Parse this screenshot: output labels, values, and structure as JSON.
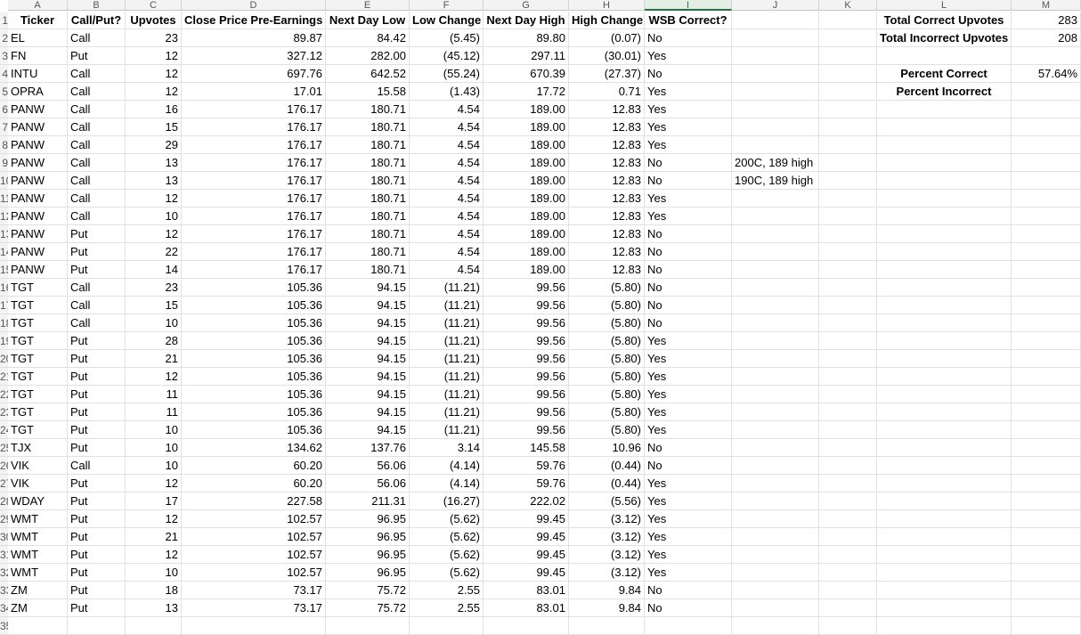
{
  "column_letters": [
    "A",
    "B",
    "C",
    "D",
    "E",
    "F",
    "G",
    "H",
    "I",
    "J",
    "K",
    "L",
    "M"
  ],
  "row_numbers": [
    "1",
    "2",
    "3",
    "4",
    "5",
    "6",
    "7",
    "8",
    "9",
    "10",
    "11",
    "12",
    "13",
    "14",
    "15",
    "16",
    "17",
    "18",
    "19",
    "20",
    "21",
    "22",
    "23",
    "24",
    "25",
    "26",
    "27",
    "28",
    "29",
    "30",
    "31",
    "32",
    "33",
    "34",
    "35"
  ],
  "headers": [
    "Ticker",
    "Call/Put?",
    "Upvotes",
    "Close Price Pre-Earnings",
    "Next Day Low",
    "Low Change",
    "Next Day High",
    "High Change",
    "WSB Correct?"
  ],
  "rows": [
    [
      "EL",
      "Call",
      "23",
      "89.87",
      "84.42",
      "(5.45)",
      "89.80",
      "(0.07)",
      "No"
    ],
    [
      "FN",
      "Put",
      "12",
      "327.12",
      "282.00",
      "(45.12)",
      "297.11",
      "(30.01)",
      "Yes"
    ],
    [
      "INTU",
      "Call",
      "12",
      "697.76",
      "642.52",
      "(55.24)",
      "670.39",
      "(27.37)",
      "No"
    ],
    [
      "OPRA",
      "Call",
      "12",
      "17.01",
      "15.58",
      "(1.43)",
      "17.72",
      "0.71",
      "Yes"
    ],
    [
      "PANW",
      "Call",
      "16",
      "176.17",
      "180.71",
      "4.54",
      "189.00",
      "12.83",
      "Yes"
    ],
    [
      "PANW",
      "Call",
      "15",
      "176.17",
      "180.71",
      "4.54",
      "189.00",
      "12.83",
      "Yes"
    ],
    [
      "PANW",
      "Call",
      "29",
      "176.17",
      "180.71",
      "4.54",
      "189.00",
      "12.83",
      "Yes"
    ],
    [
      "PANW",
      "Call",
      "13",
      "176.17",
      "180.71",
      "4.54",
      "189.00",
      "12.83",
      "No"
    ],
    [
      "PANW",
      "Call",
      "13",
      "176.17",
      "180.71",
      "4.54",
      "189.00",
      "12.83",
      "No"
    ],
    [
      "PANW",
      "Call",
      "12",
      "176.17",
      "180.71",
      "4.54",
      "189.00",
      "12.83",
      "Yes"
    ],
    [
      "PANW",
      "Call",
      "10",
      "176.17",
      "180.71",
      "4.54",
      "189.00",
      "12.83",
      "Yes"
    ],
    [
      "PANW",
      "Put",
      "12",
      "176.17",
      "180.71",
      "4.54",
      "189.00",
      "12.83",
      "No"
    ],
    [
      "PANW",
      "Put",
      "22",
      "176.17",
      "180.71",
      "4.54",
      "189.00",
      "12.83",
      "No"
    ],
    [
      "PANW",
      "Put",
      "14",
      "176.17",
      "180.71",
      "4.54",
      "189.00",
      "12.83",
      "No"
    ],
    [
      "TGT",
      "Call",
      "23",
      "105.36",
      "94.15",
      "(11.21)",
      "99.56",
      "(5.80)",
      "No"
    ],
    [
      "TGT",
      "Call",
      "15",
      "105.36",
      "94.15",
      "(11.21)",
      "99.56",
      "(5.80)",
      "No"
    ],
    [
      "TGT",
      "Call",
      "10",
      "105.36",
      "94.15",
      "(11.21)",
      "99.56",
      "(5.80)",
      "No"
    ],
    [
      "TGT",
      "Put",
      "28",
      "105.36",
      "94.15",
      "(11.21)",
      "99.56",
      "(5.80)",
      "Yes"
    ],
    [
      "TGT",
      "Put",
      "21",
      "105.36",
      "94.15",
      "(11.21)",
      "99.56",
      "(5.80)",
      "Yes"
    ],
    [
      "TGT",
      "Put",
      "12",
      "105.36",
      "94.15",
      "(11.21)",
      "99.56",
      "(5.80)",
      "Yes"
    ],
    [
      "TGT",
      "Put",
      "11",
      "105.36",
      "94.15",
      "(11.21)",
      "99.56",
      "(5.80)",
      "Yes"
    ],
    [
      "TGT",
      "Put",
      "11",
      "105.36",
      "94.15",
      "(11.21)",
      "99.56",
      "(5.80)",
      "Yes"
    ],
    [
      "TGT",
      "Put",
      "10",
      "105.36",
      "94.15",
      "(11.21)",
      "99.56",
      "(5.80)",
      "Yes"
    ],
    [
      "TJX",
      "Put",
      "10",
      "134.62",
      "137.76",
      "3.14",
      "145.58",
      "10.96",
      "No"
    ],
    [
      "VIK",
      "Call",
      "10",
      "60.20",
      "56.06",
      "(4.14)",
      "59.76",
      "(0.44)",
      "No"
    ],
    [
      "VIK",
      "Put",
      "12",
      "60.20",
      "56.06",
      "(4.14)",
      "59.76",
      "(0.44)",
      "Yes"
    ],
    [
      "WDAY",
      "Put",
      "17",
      "227.58",
      "211.31",
      "(16.27)",
      "222.02",
      "(5.56)",
      "Yes"
    ],
    [
      "WMT",
      "Put",
      "12",
      "102.57",
      "96.95",
      "(5.62)",
      "99.45",
      "(3.12)",
      "Yes"
    ],
    [
      "WMT",
      "Put",
      "21",
      "102.57",
      "96.95",
      "(5.62)",
      "99.45",
      "(3.12)",
      "Yes"
    ],
    [
      "WMT",
      "Put",
      "12",
      "102.57",
      "96.95",
      "(5.62)",
      "99.45",
      "(3.12)",
      "Yes"
    ],
    [
      "WMT",
      "Put",
      "10",
      "102.57",
      "96.95",
      "(5.62)",
      "99.45",
      "(3.12)",
      "Yes"
    ],
    [
      "ZM",
      "Put",
      "18",
      "73.17",
      "75.72",
      "2.55",
      "83.01",
      "9.84",
      "No"
    ],
    [
      "ZM",
      "Put",
      "13",
      "73.17",
      "75.72",
      "2.55",
      "83.01",
      "9.84",
      "No"
    ]
  ],
  "notes": {
    "row9": "200C, 189 high",
    "row10": "190C, 189 high"
  },
  "summary": {
    "total_correct_label": "Total Correct Upvotes",
    "total_correct_value": "283",
    "total_incorrect_label": "Total Incorrect Upvotes",
    "total_incorrect_value": "208",
    "percent_correct_label": "Percent Correct",
    "percent_correct_value": "57.64%",
    "percent_incorrect_label": "Percent Incorrect"
  },
  "colors": {
    "selected_column": "#217346",
    "grid": "#e1e1e1",
    "header_bg": "#f3f3f3"
  }
}
